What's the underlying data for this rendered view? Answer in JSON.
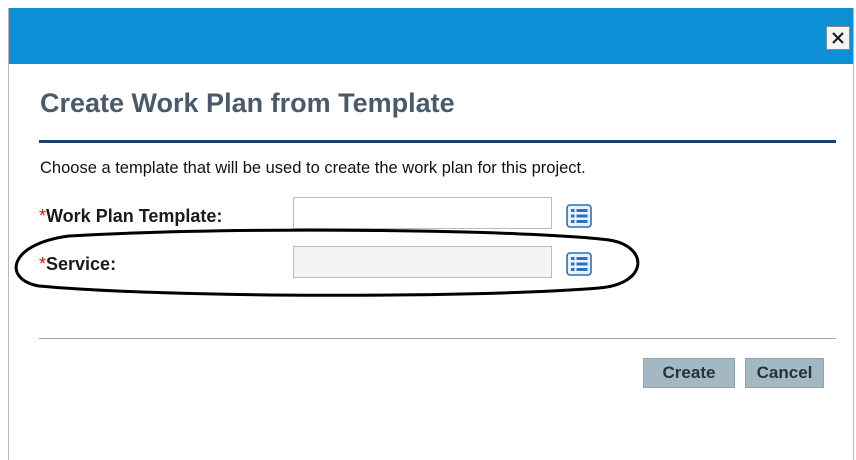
{
  "dialog": {
    "title": "Create Work Plan from Template",
    "instructions": "Choose a template that will be used to create the work plan for this project.",
    "close_icon": "close-icon"
  },
  "fields": [
    {
      "required_marker": "*",
      "label": "Work Plan Template:",
      "value": "",
      "icon": "list-icon"
    },
    {
      "required_marker": "*",
      "label": "Service:",
      "value": "",
      "icon": "list-icon",
      "highlighted": true
    }
  ],
  "buttons": {
    "create_label": "Create",
    "cancel_label": "Cancel"
  },
  "colors": {
    "title_bar": "#0d8fd6",
    "heading_text": "#4a5a6a",
    "heading_rule": "#1d3f6e",
    "required_marker": "#d21a1a",
    "button_background": "#a4b8c4",
    "list_icon": "#2a6fc2"
  }
}
